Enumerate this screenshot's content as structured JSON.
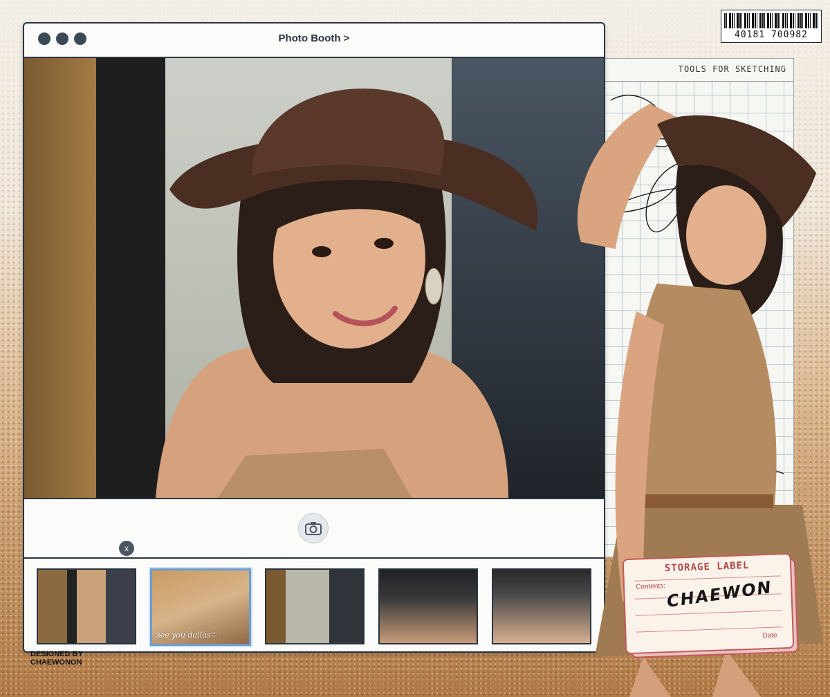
{
  "barcode": {
    "number": "40181 700982"
  },
  "sketch": {
    "header": "TOOLS FOR SKETCHING"
  },
  "window": {
    "title": "Photo Booth >"
  },
  "thumbnails": [
    {
      "caption": ""
    },
    {
      "caption": "see you dallas♡"
    },
    {
      "caption": ""
    },
    {
      "caption": ""
    },
    {
      "caption": ""
    }
  ],
  "delete_badge": "x",
  "credit": {
    "line1": "DESIGNED BY",
    "line2": "CHAEWONON"
  },
  "storage_label": {
    "title": "STORAGE LABEL",
    "contents_label": "Contents:",
    "signature": "CHAEWON",
    "date_label": "Date"
  },
  "colors": {
    "window_border": "#2a3440",
    "label_red": "#b04848",
    "accent_blue": "#6b9cd0"
  }
}
